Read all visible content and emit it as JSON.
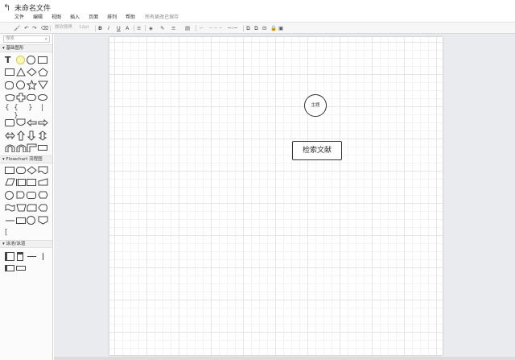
{
  "titlebar": {
    "back_icon": "↰",
    "title": "未命名文件",
    "menu": [
      "文件",
      "编辑",
      "视图",
      "插入",
      "页面",
      "排列",
      "帮助"
    ],
    "save_status": "所有更改已保存"
  },
  "toolbar": {
    "font_name": "微软雅黑",
    "font_size": "12pt",
    "bold": "B",
    "italic": "I",
    "underline": "U",
    "strike": "A"
  },
  "sidebar": {
    "search_placeholder": "搜索",
    "search_icon": "⌕",
    "sections": [
      {
        "title": "基础图形"
      },
      {
        "title": "Flowchart 流程图"
      },
      {
        "title": "泳池/泳道"
      }
    ]
  },
  "canvas": {
    "circle_node": "主题",
    "rect_node": "检索文献"
  }
}
